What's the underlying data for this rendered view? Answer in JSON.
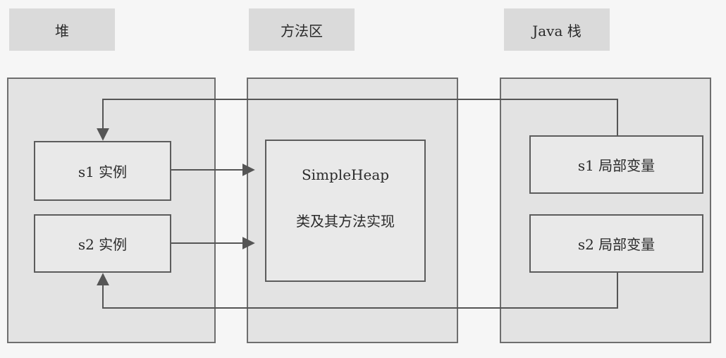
{
  "headers": {
    "heap": "堆",
    "method_area": "方法区",
    "java_stack": "Java 栈"
  },
  "heap": {
    "s1_instance": "s1 实例",
    "s2_instance": "s2 实例"
  },
  "method_area": {
    "class_name": "SimpleHeap",
    "class_desc": "类及其方法实现"
  },
  "java_stack": {
    "s1_local": "s1 局部变量",
    "s2_local": "s2 局部变量"
  },
  "colors": {
    "background": "#f6f6f6",
    "header_fill": "#dadada",
    "region_fill": "#e3e3e3",
    "box_fill": "#e9e9e9",
    "line": "#555555"
  }
}
